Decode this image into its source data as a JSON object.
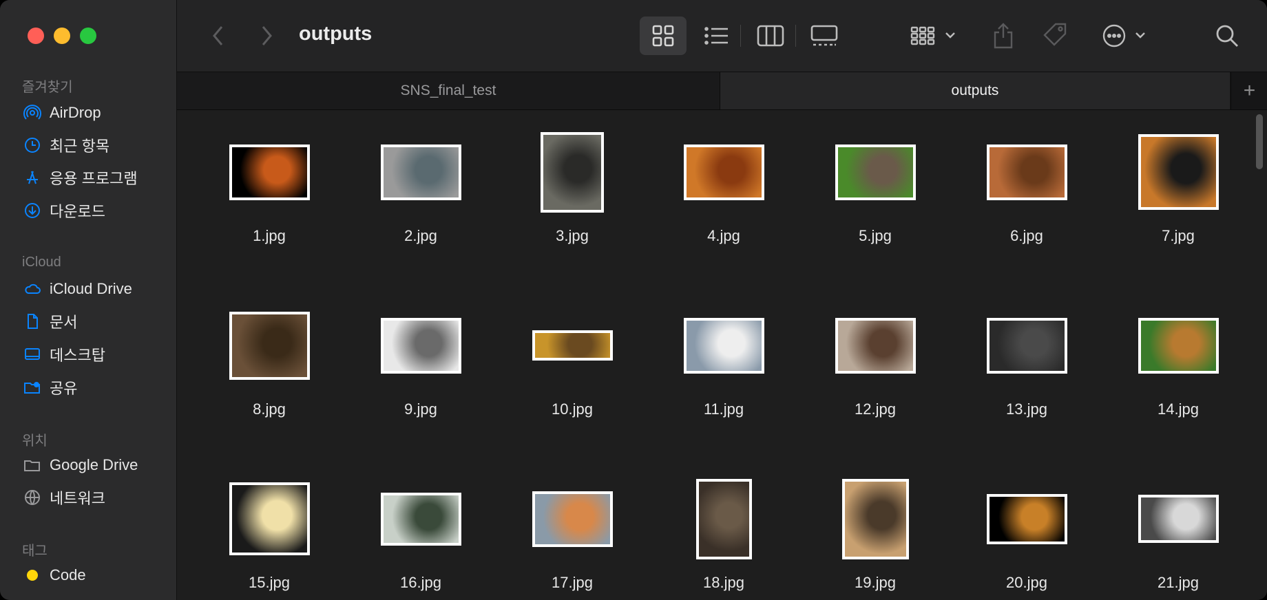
{
  "sidebar": {
    "sections": {
      "favorites": "즐겨찾기",
      "icloud": "iCloud",
      "locations": "위치",
      "tags": "태그"
    },
    "favorites": [
      {
        "label": "AirDrop",
        "icon": "airdrop-icon"
      },
      {
        "label": "최근 항목",
        "icon": "clock-icon"
      },
      {
        "label": "응용 프로그램",
        "icon": "applications-icon"
      },
      {
        "label": "다운로드",
        "icon": "download-icon"
      }
    ],
    "icloud": [
      {
        "label": "iCloud Drive",
        "icon": "cloud-icon"
      },
      {
        "label": "문서",
        "icon": "document-icon"
      },
      {
        "label": "데스크탑",
        "icon": "desktop-icon"
      },
      {
        "label": "공유",
        "icon": "shared-folder-icon"
      }
    ],
    "locations": [
      {
        "label": "Google Drive",
        "icon": "folder-icon"
      },
      {
        "label": "네트워크",
        "icon": "network-icon"
      }
    ],
    "tags": [
      {
        "label": "Code",
        "color": "#ffd60a"
      }
    ]
  },
  "toolbar": {
    "title": "outputs",
    "accent": "#0a84ff"
  },
  "tabs": [
    {
      "label": "SNS_final_test",
      "active": false
    },
    {
      "label": "outputs",
      "active": true
    }
  ],
  "files": [
    {
      "name": "1.jpg",
      "thumb": {
        "w": 0.53,
        "h": 0.37,
        "bg": "#000000",
        "fg": "#c85a1a"
      }
    },
    {
      "name": "2.jpg",
      "thumb": {
        "w": 0.53,
        "h": 0.37,
        "bg": "#9a9a9a",
        "fg": "#5a6a70"
      }
    },
    {
      "name": "3.jpg",
      "thumb": {
        "w": 0.42,
        "h": 0.53,
        "bg": "#6a6a62",
        "fg": "#2a2a28"
      }
    },
    {
      "name": "4.jpg",
      "thumb": {
        "w": 0.53,
        "h": 0.37,
        "bg": "#d07828",
        "fg": "#8a3a10"
      }
    },
    {
      "name": "5.jpg",
      "thumb": {
        "w": 0.53,
        "h": 0.37,
        "bg": "#4a8a2a",
        "fg": "#6a5a4a"
      }
    },
    {
      "name": "6.jpg",
      "thumb": {
        "w": 0.53,
        "h": 0.37,
        "bg": "#b86a38",
        "fg": "#6a3a1a"
      }
    },
    {
      "name": "7.jpg",
      "thumb": {
        "w": 0.53,
        "h": 0.5,
        "bg": "#c8782a",
        "fg": "#1a1a1a"
      }
    },
    {
      "name": "8.jpg",
      "thumb": {
        "w": 0.53,
        "h": 0.45,
        "bg": "#6a5038",
        "fg": "#3a2a18"
      }
    },
    {
      "name": "9.jpg",
      "thumb": {
        "w": 0.53,
        "h": 0.37,
        "bg": "#e8e8e8",
        "fg": "#6a6a6a"
      }
    },
    {
      "name": "10.jpg",
      "thumb": {
        "w": 0.53,
        "h": 0.2,
        "bg": "#c8942a",
        "fg": "#6a4a20"
      }
    },
    {
      "name": "11.jpg",
      "thumb": {
        "w": 0.53,
        "h": 0.37,
        "bg": "#8a9aaa",
        "fg": "#eeeeee"
      }
    },
    {
      "name": "12.jpg",
      "thumb": {
        "w": 0.53,
        "h": 0.37,
        "bg": "#b8a898",
        "fg": "#5a4030"
      }
    },
    {
      "name": "13.jpg",
      "thumb": {
        "w": 0.53,
        "h": 0.37,
        "bg": "#2a2a2a",
        "fg": "#4a4a4a"
      }
    },
    {
      "name": "14.jpg",
      "thumb": {
        "w": 0.53,
        "h": 0.37,
        "bg": "#3a7a2a",
        "fg": "#b87a30"
      }
    },
    {
      "name": "15.jpg",
      "thumb": {
        "w": 0.53,
        "h": 0.48,
        "bg": "#1a1a1a",
        "fg": "#f0e0a8"
      }
    },
    {
      "name": "16.jpg",
      "thumb": {
        "w": 0.53,
        "h": 0.35,
        "bg": "#c8d0c8",
        "fg": "#3a4a3a"
      }
    },
    {
      "name": "17.jpg",
      "thumb": {
        "w": 0.53,
        "h": 0.37,
        "bg": "#8a9aa8",
        "fg": "#d8884a"
      }
    },
    {
      "name": "18.jpg",
      "thumb": {
        "w": 0.37,
        "h": 0.53,
        "bg": "#3a3028",
        "fg": "#6a5a48"
      }
    },
    {
      "name": "19.jpg",
      "thumb": {
        "w": 0.44,
        "h": 0.53,
        "bg": "#c8a070",
        "fg": "#4a3a2a"
      }
    },
    {
      "name": "20.jpg",
      "thumb": {
        "w": 0.53,
        "h": 0.33,
        "bg": "#000000",
        "fg": "#c88028"
      }
    },
    {
      "name": "21.jpg",
      "thumb": {
        "w": 0.53,
        "h": 0.32,
        "bg": "#4a4a4a",
        "fg": "#d8d8d8"
      }
    }
  ]
}
